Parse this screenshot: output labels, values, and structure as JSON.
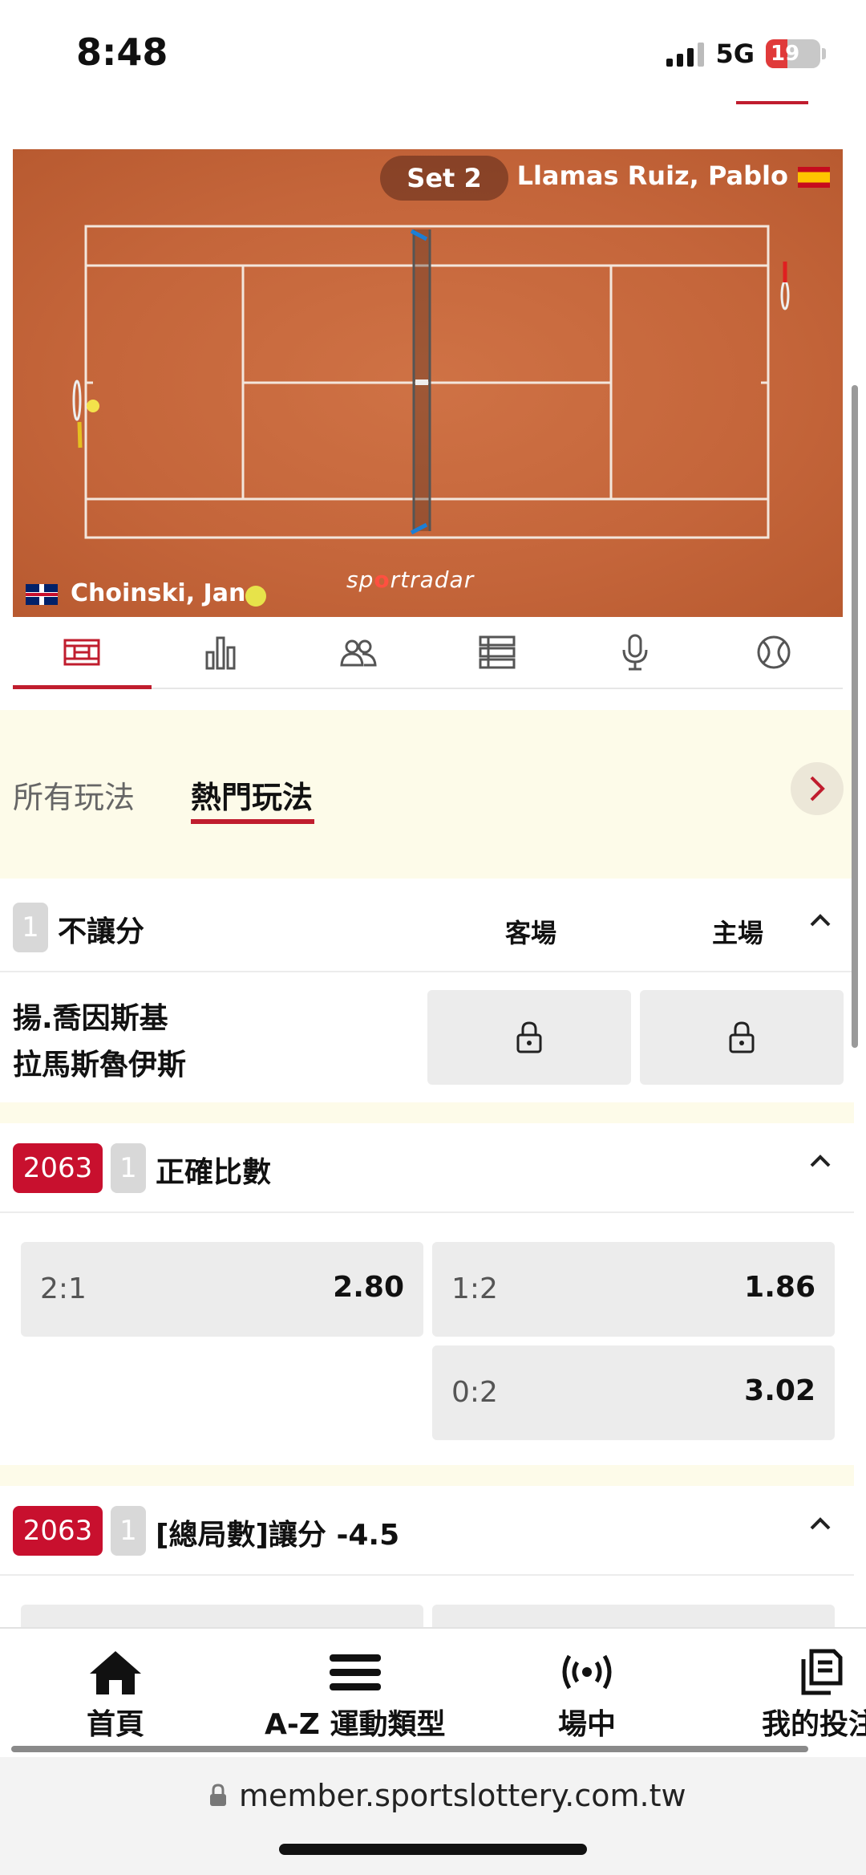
{
  "status_bar": {
    "time": "8:48",
    "network": "5G",
    "battery": "19"
  },
  "scoreboard": {
    "set_label": "Set 2",
    "player_top": "Llamas Ruiz, Pablo",
    "player_bottom": "Choinski, Jan",
    "brand_prefix": "sp",
    "brand_o": "o",
    "brand_suffix": "rtradar"
  },
  "viz_tabs": [
    "court-icon",
    "stats-icon",
    "players-icon",
    "list-icon",
    "microphone-icon",
    "tennis-ball-icon"
  ],
  "filter": {
    "all_label": "所有玩法",
    "hot_label": "熱門玩法"
  },
  "market_moneyline": {
    "num": "1",
    "title": "不讓分",
    "col_away": "客場",
    "col_home": "主場",
    "team_a": "揚.喬因斯基",
    "team_b": "拉馬斯魯伊斯"
  },
  "market_correct_score": {
    "id": "2063",
    "num": "1",
    "title": "正確比數",
    "odds": [
      {
        "label": "2:1",
        "price": "2.80"
      },
      {
        "label": "1:2",
        "price": "1.86"
      },
      {
        "label": "0:2",
        "price": "3.02"
      }
    ]
  },
  "market_total_games": {
    "id": "2063",
    "num": "1",
    "title": "[總局數]讓分 -4.5"
  },
  "bottom_nav": {
    "home": "首頁",
    "az": "A-Z 運動類型",
    "live": "場中",
    "bets": "我的投注"
  },
  "url_bar": {
    "url": "member.sportslottery.com.tw"
  },
  "colors": {
    "accent": "#c01d2e",
    "court": "#c86a3f",
    "cream": "#fdfbe9"
  }
}
